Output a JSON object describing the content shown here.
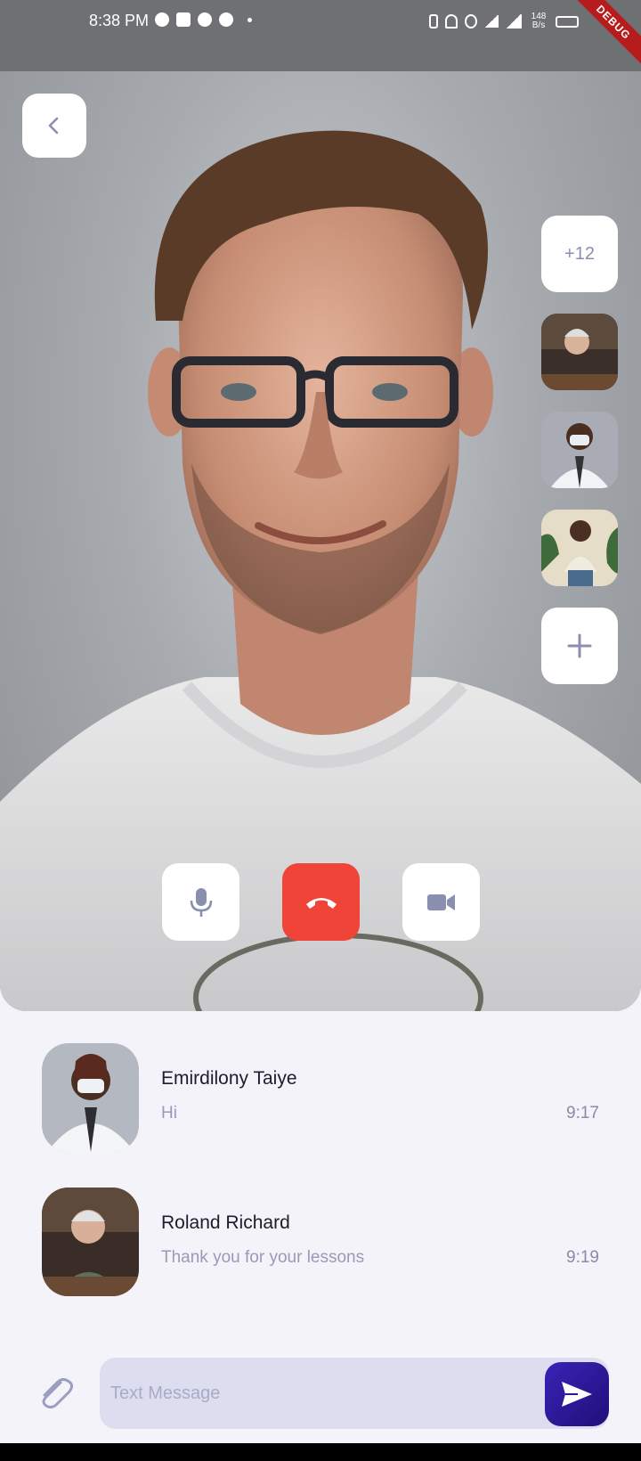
{
  "status_bar": {
    "time": "8:38 PM",
    "network_speed": "148 B/s",
    "debug_banner": "DEBUG"
  },
  "call": {
    "participants_more": "+12",
    "controls": {
      "mic": "microphone-icon",
      "end": "end-call-icon",
      "video": "video-camera-icon"
    },
    "end_color": "#f04438"
  },
  "messages": [
    {
      "name": "Emirdilony Taiye",
      "text": "Hi",
      "time": "9:17"
    },
    {
      "name": "Roland Richard",
      "text": "Thank you for your lessons",
      "time": "9:19"
    }
  ],
  "composer": {
    "placeholder": "Text Message",
    "send_color": "#2a179a"
  }
}
